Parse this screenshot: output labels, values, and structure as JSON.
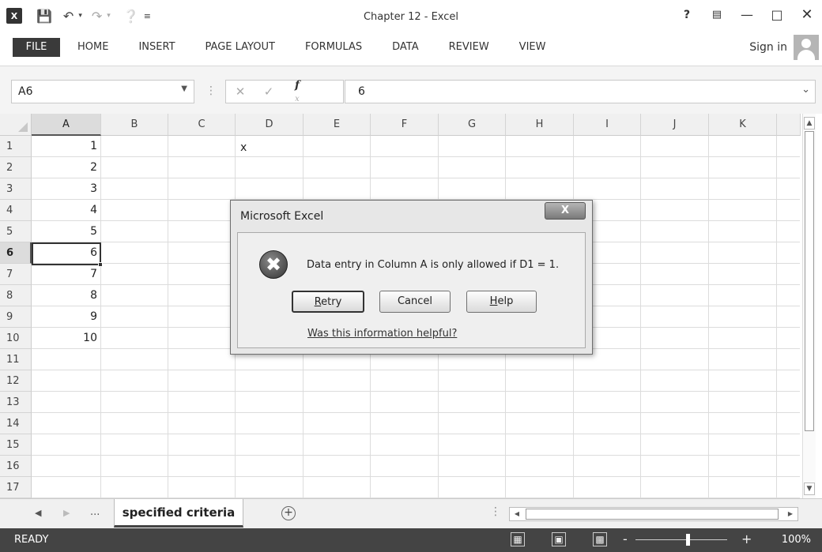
{
  "window": {
    "title": "Chapter 12 - Excel"
  },
  "ribbon": {
    "tabs": [
      "FILE",
      "HOME",
      "INSERT",
      "PAGE LAYOUT",
      "FORMULAS",
      "DATA",
      "REVIEW",
      "VIEW"
    ],
    "sign_in": "Sign in"
  },
  "formula_bar": {
    "name_box": "A6",
    "fx_label": "f",
    "content": "6"
  },
  "grid": {
    "columns": [
      "A",
      "B",
      "C",
      "D",
      "E",
      "F",
      "G",
      "H",
      "I",
      "J",
      "K"
    ],
    "rows": [
      "1",
      "2",
      "3",
      "4",
      "5",
      "6",
      "7",
      "8",
      "9",
      "10",
      "11",
      "12",
      "13",
      "14",
      "15",
      "16",
      "17"
    ],
    "column_a_values": [
      "1",
      "2",
      "3",
      "4",
      "5",
      "6",
      "7",
      "8",
      "9",
      "10"
    ],
    "d1_value": "x"
  },
  "dialog": {
    "title": "Microsoft Excel",
    "close_label": "X",
    "message": "Data entry in Column A is only allowed if D1 = 1.",
    "retry_label": "R",
    "retry_rest": "etry",
    "cancel_label": "Cancel",
    "help_label": "H",
    "help_rest": "elp",
    "help_link": "Was this information helpful?"
  },
  "sheet_tabs": {
    "ellipsis": "...",
    "active_sheet": "specified criteria",
    "add_sheet": "+"
  },
  "status_bar": {
    "status": "READY",
    "zoom_minus": "-",
    "zoom_plus": "+",
    "zoom": "100%"
  }
}
